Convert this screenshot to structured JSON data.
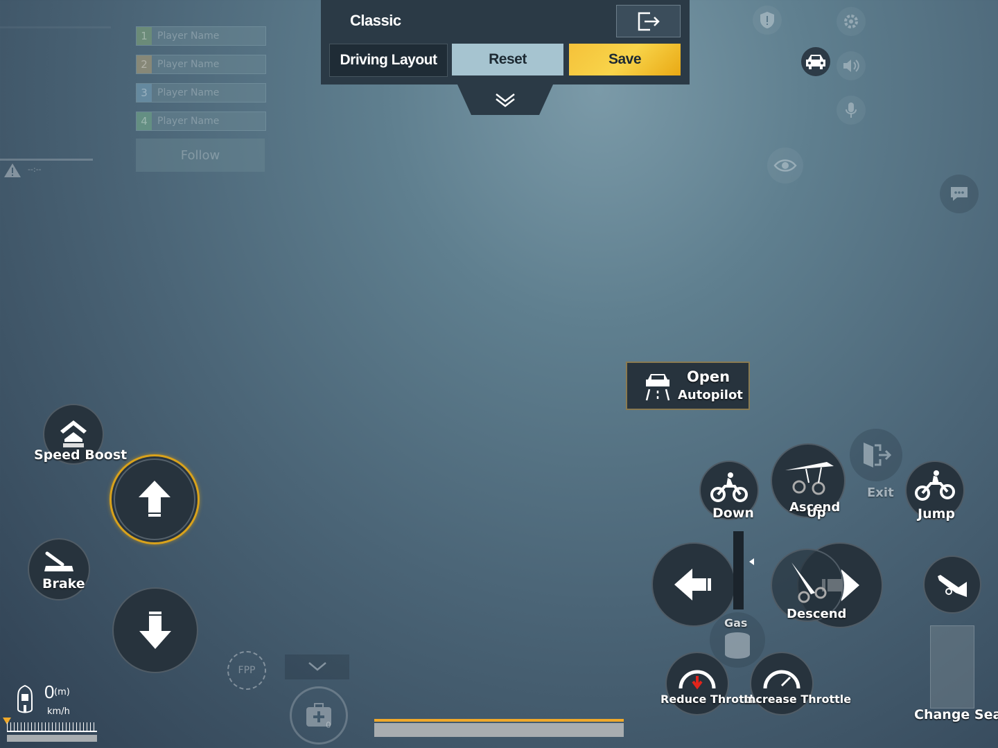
{
  "layout_panel": {
    "title": "Classic",
    "driving_layout_label": "Driving Layout",
    "reset_label": "Reset",
    "save_label": "Save"
  },
  "team": {
    "members": [
      {
        "num": "1",
        "name": "Player Name",
        "color": "#7ca06b"
      },
      {
        "num": "2",
        "name": "Player Name",
        "color": "#b39a6a"
      },
      {
        "num": "3",
        "name": "Player Name",
        "color": "#6f9cb7"
      },
      {
        "num": "4",
        "name": "Player Name",
        "color": "#6ea87f"
      }
    ],
    "follow_label": "Follow"
  },
  "left_status": {
    "time": "--:--"
  },
  "controls": {
    "speed_boost": "Speed Boost",
    "brake": "Brake",
    "open_autopilot_line1": "Open",
    "open_autopilot_line2": "Autopilot",
    "down": "Down",
    "ascend": "Ascend",
    "up": "Up",
    "exit": "Exit",
    "jump": "Jump",
    "descend": "Descend",
    "gas": "Gas",
    "reduce_throttle": "Reduce Throttle",
    "increase_throttle": "Increase Throttle",
    "change_seat": "Change Seat",
    "fpp": "FPP"
  },
  "speedometer": {
    "altitude_value": "0",
    "altitude_unit": "(m)",
    "speed_unit": "km/h"
  },
  "minimap_count": "0",
  "colors": {
    "accent_yellow": "#f5c23a",
    "reset_blue": "#a6c4d0",
    "panel_dark": "#2b3a46"
  }
}
